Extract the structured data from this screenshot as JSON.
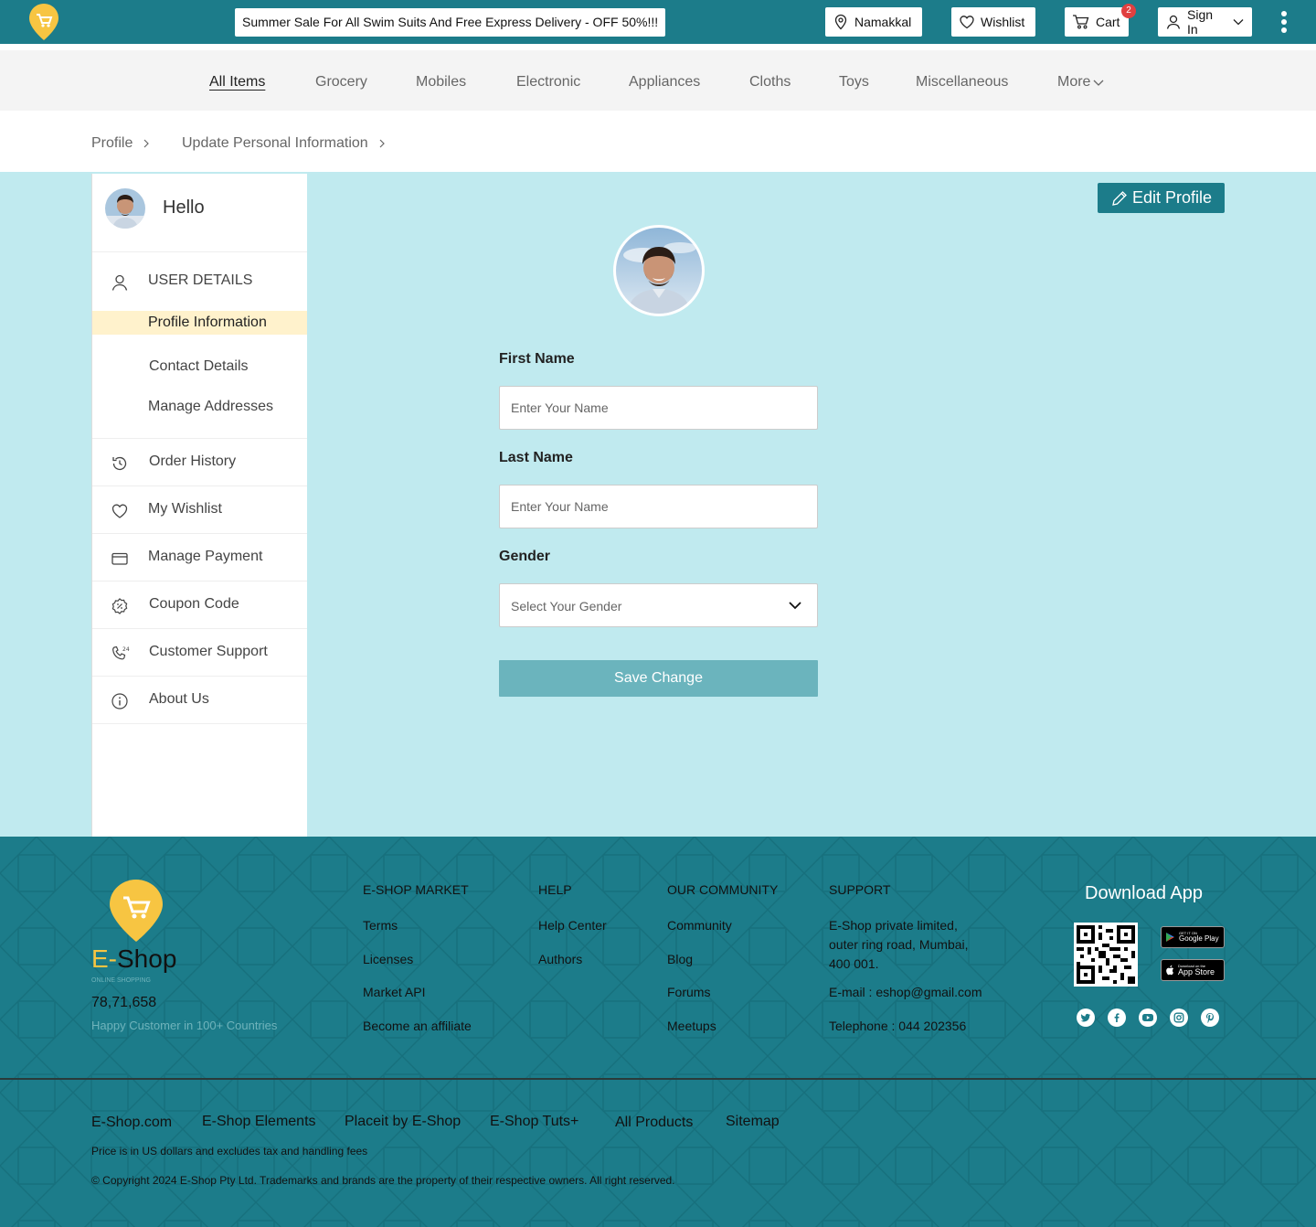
{
  "header": {
    "promo": "Summer Sale For All Swim Suits And Free Express Delivery - OFF 50%!!!",
    "location": "Namakkal",
    "wishlist": "Wishlist",
    "cart": "Cart",
    "cart_count": "2",
    "sign_in": "Sign In"
  },
  "nav": {
    "items": [
      "All Items",
      "Grocery",
      "Mobiles",
      "Electronic",
      "Appliances",
      "Cloths",
      "Toys",
      "Miscellaneous",
      "More"
    ]
  },
  "breadcrumb": [
    "Profile",
    "Update Personal Information"
  ],
  "sidebar": {
    "greeting": "Hello",
    "section": "USER DETAILS",
    "sub_items": [
      "Profile Information",
      "Contact Details",
      "Manage Addresses"
    ],
    "items": [
      "Order History",
      "My Wishlist",
      "Manage Payment",
      "Coupon Code",
      "Customer Support",
      "About Us"
    ]
  },
  "form": {
    "edit_label": "Edit Profile",
    "first_name_label": "First Name",
    "first_name_placeholder": "Enter Your Name",
    "last_name_label": "Last Name",
    "last_name_placeholder": "Enter Your Name",
    "gender_label": "Gender",
    "gender_placeholder": "Select Your Gender",
    "save_label": "Save Change"
  },
  "footer": {
    "brand_e": "E-",
    "brand_shop": "Shop",
    "brand_tagline": "ONLINE SHOPPING",
    "customers": "78,71,658",
    "customers_caption": "Happy Customer in 100+ Countries",
    "market_heading": "E-SHOP  MARKET",
    "market_links": [
      "Terms",
      "Licenses",
      "Market API",
      "Become an affiliate"
    ],
    "help_heading": "HELP",
    "help_links": [
      "Help Center",
      "Authors"
    ],
    "community_heading": "OUR COMMUNITY",
    "community_links": [
      "Community",
      "Blog",
      "Forums",
      "Meetups"
    ],
    "support_heading": "SUPPORT",
    "support_address": [
      "E-Shop private limited,",
      "outer ring road, Mumbai,",
      "400 001."
    ],
    "support_email": "E-mail : eshop@gmail.com",
    "support_phone": "Telephone : 044 202356",
    "download_heading": "Download App",
    "google_play_small": "GET IT ON",
    "google_play": "Google Play",
    "app_store_small": "Download on the",
    "app_store": "App Store",
    "bottom_links": [
      "E-Shop.com",
      "E-Shop Elements",
      "Placeit by E-Shop",
      "E-Shop  Tuts+",
      "All Products",
      "Sitemap"
    ],
    "price_note": "Price is in US dollars and excludes tax and handling fees",
    "copyright": "© Copyright 2024 E-Shop Pty Ltd. Trademarks and brands are the property of their respective owners. All right reserved."
  },
  "colors": {
    "primary": "#1c7c8a",
    "main_bg": "#c0eaef",
    "accent": "#f7c542",
    "save_button": "#6bb4bd"
  }
}
